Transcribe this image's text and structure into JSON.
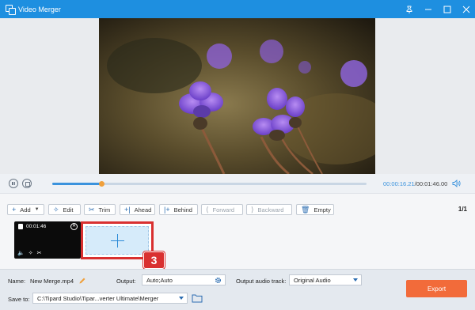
{
  "window": {
    "title": "Video Merger",
    "icon": "merge-windows-icon",
    "controls": [
      "pin-icon",
      "minimize-icon",
      "maximize-icon",
      "close-icon"
    ]
  },
  "player": {
    "current_time": "00:00:16.21",
    "total_time": "/00:01:46.00",
    "progress": 0.155
  },
  "toolbar": {
    "add": "Add",
    "edit": "Edit",
    "trim": "Trim",
    "ahead": "Ahead",
    "behind": "Behind",
    "forward": "Forward",
    "backward": "Backward",
    "empty": "Empty",
    "page": "1/1"
  },
  "clip": {
    "duration": "00:01:46"
  },
  "step_badge": "3",
  "output": {
    "name_label": "Name:",
    "name_value": "New Merge.mp4",
    "output_label": "Output:",
    "output_value": "Auto;Auto",
    "audio_label": "Output audio track:",
    "audio_value": "Original Audio",
    "save_label": "Save to:",
    "save_value": "C:\\Tipard Studio\\Tipar...verter Ultimate\\Merger",
    "export_label": "Export"
  },
  "colors": {
    "title_bar": "#1e8fe0",
    "accent": "#3b93dd",
    "export": "#f26b3a",
    "highlight": "#d93030"
  }
}
